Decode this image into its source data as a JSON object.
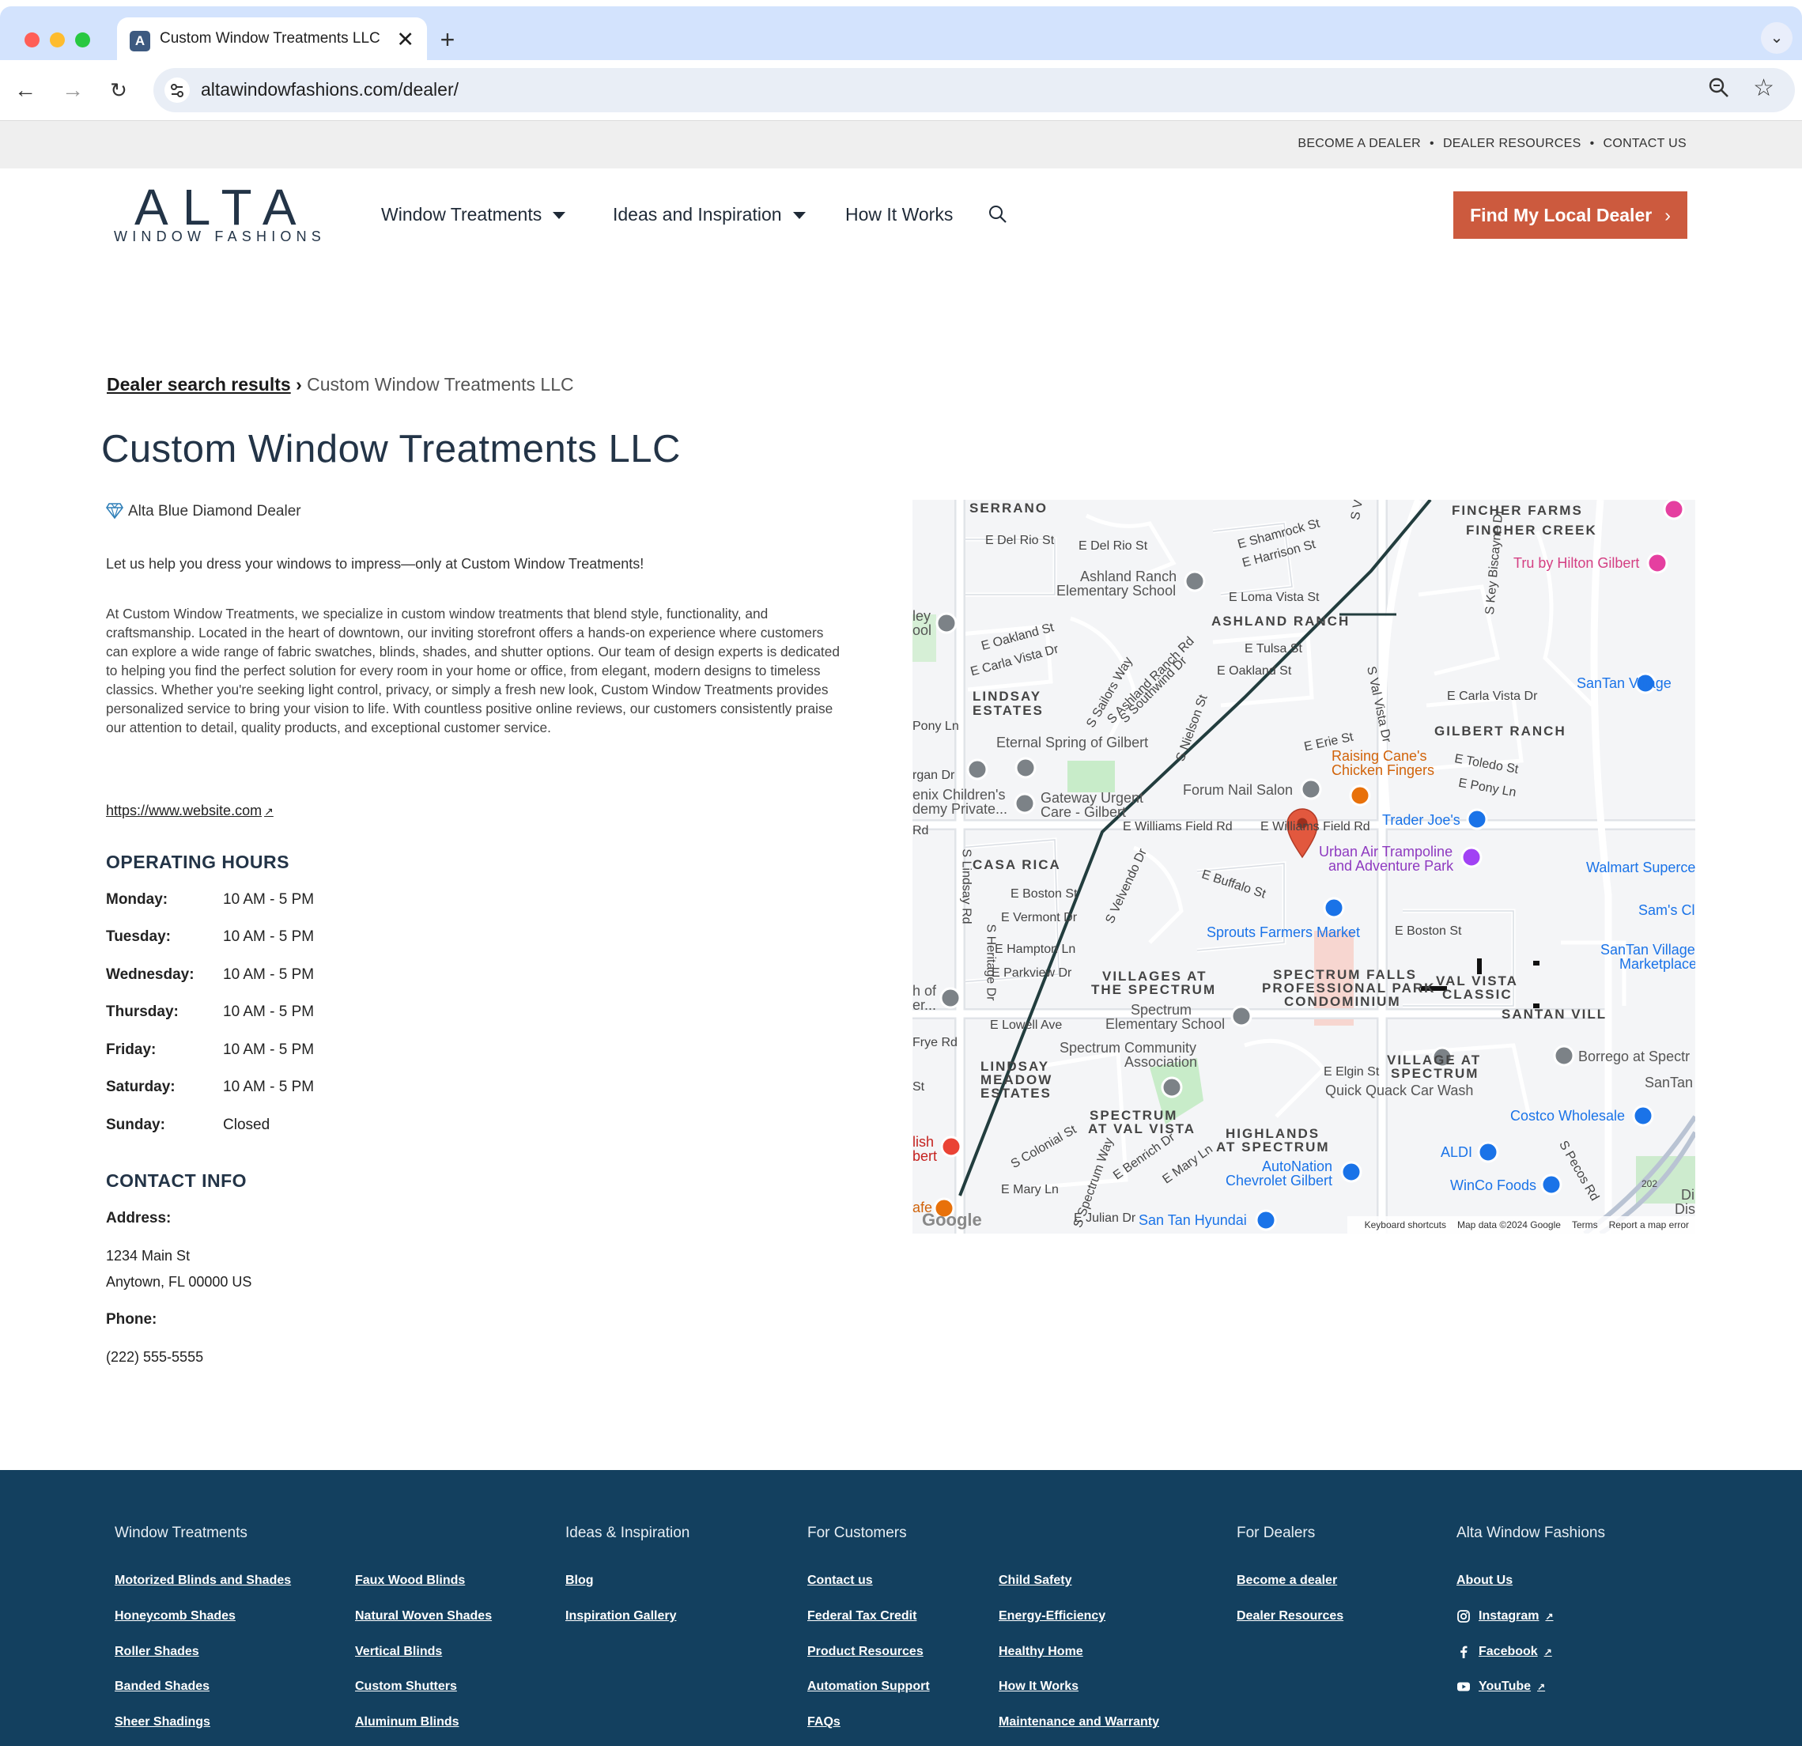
{
  "browser": {
    "tab_title": "Custom Window Treatments LLC",
    "tab_favicon": "A",
    "url": "altawindowfashions.com/dealer/"
  },
  "utility_nav": [
    "BECOME A DEALER",
    "DEALER RESOURCES",
    "CONTACT US"
  ],
  "logo": {
    "word": "ALTA",
    "sub": "WINDOW FASHIONS"
  },
  "main_nav": {
    "window_treatments": "Window Treatments",
    "ideas": "Ideas and Inspiration",
    "how": "How It Works",
    "cta": "Find My Local Dealer"
  },
  "breadcrumb": {
    "link": "Dealer search results",
    "separator": " › ",
    "current": "Custom Window Treatments LLC"
  },
  "dealer": {
    "name": "Custom Window Treatments LLC",
    "badge": "Alta Blue Diamond Dealer",
    "tagline": "Let us help you dress your windows to impress—only at Custom Window Treatments!",
    "about": "At Custom Window Treatments, we specialize in custom window treatments that blend style, functionality, and craftsmanship. Located in the heart of downtown, our inviting storefront offers a hands-on experience where customers can explore a wide range of fabric swatches, blinds, shades, and shutter options. Our team of design experts is dedicated to helping you find the perfect solution for every room in your home or office, from elegant, modern designs to timeless classics. Whether you're seeking light control, privacy, or simply a fresh new look, Custom Window Treatments provides personalized service to bring your vision to life. With countless positive online reviews, our customers consistently praise our attention to detail, quality products, and exceptional customer service.",
    "website": "https://www.website.com"
  },
  "hours": {
    "title": "OPERATING HOURS",
    "rows": [
      {
        "day": "Monday:",
        "time": "10 AM - 5 PM"
      },
      {
        "day": "Tuesday:",
        "time": "10 AM - 5 PM"
      },
      {
        "day": "Wednesday:",
        "time": "10 AM - 5 PM"
      },
      {
        "day": "Thursday:",
        "time": "10 AM - 5 PM"
      },
      {
        "day": "Friday:",
        "time": "10 AM - 5 PM"
      },
      {
        "day": "Saturday:",
        "time": "10 AM - 5 PM"
      },
      {
        "day": "Sunday:",
        "time": "Closed"
      }
    ]
  },
  "contact": {
    "title": "CONTACT INFO",
    "address_label": "Address:",
    "address_line1": "1234 Main St",
    "address_line2": "Anytown, FL 00000 US",
    "phone_label": "Phone:",
    "phone": "(222) 555-5555"
  },
  "map": {
    "neighborhoods": [
      "SERRANO",
      "FINCHER FARMS",
      "FINCHER CREEK",
      "ASHLAND RANCH",
      "LINDSAY",
      "ESTATES",
      "GILBERT RANCH",
      "CASA RICA",
      "VILLAGES AT",
      "THE SPECTRUM",
      "SPECTRUM FALLS",
      "PROFESSIONAL PARK",
      "CONDOMINIUM",
      "VAL VISTA",
      "CLASSIC",
      "SANTAN VILL",
      "VILLAGE AT",
      "SPECTRUM",
      "LINDSAY",
      "MEADOW",
      "ESTATES",
      "SPECTRUM",
      "AT VAL VISTA",
      "HIGHLANDS",
      "AT SPECTRUM"
    ],
    "streets": [
      "E Del Rio St",
      "E Del Rio St",
      "E Shamrock St",
      "E Harrison St",
      "E Loma Vista St",
      "E Oakland St",
      "E Carla Vista Dr",
      "E Tulsa St",
      "E Oakland St",
      "E Carla Vista Dr",
      "E Erie St",
      "E Toledo St",
      "E Pony Ln",
      "E Williams Field Rd",
      "E Williams Field Rd",
      "E Buffalo St",
      "E Boston St",
      "E Vermont Dr",
      "E Hampton Ln",
      "E Parkview Dr",
      "E Boston St",
      "E Lowell Ave",
      "E Elgin St",
      "E Mary Ln",
      "E Julian Dr",
      "S Colonial St",
      "S Lindsay Rd",
      "S Val Vista Dr",
      "S Velvendo Dr",
      "S Heritage Dr",
      "S Nielson St",
      "S Pecos Rd",
      "S Key Biscayne Dr",
      "S Ashland Ranch Rd",
      "S Southwind Dr",
      "S Sailors Way",
      "E Benrich Dr",
      "E Mary Ln",
      "S Spectrum Way",
      "S V"
    ],
    "places": [
      "Ashland Ranch",
      "Elementary School",
      "Eternal Spring of Gilbert",
      "Gateway Urgent",
      "Care - Gilbert",
      "Forum Nail Salon",
      "Raising Cane's",
      "Chicken Fingers",
      "Trader Joe's",
      "Urban Air Trampoline",
      "and Adventure Park",
      "Walmart Superce",
      "Sam's Cl",
      "SanTan Village",
      "Marketplace",
      "SanTan Village",
      "Tru by Hilton Gilbert",
      "Sprouts Farmers Market",
      "Spectrum",
      "Elementary School",
      "Spectrum Community",
      "Association",
      "Quick Quack Car Wash",
      "Borrego at Spectr",
      "SanTan",
      "Costco Wholesale",
      "ALDI",
      "WinCo Foods",
      "AutoNation",
      "Chevrolet Gilbert",
      "San Tan Hyundai",
      "enix Children's",
      "demy Private...",
      "ley",
      "ool",
      "Pony Ln",
      "rgan Dr",
      "Rd",
      "h of",
      "er...",
      "Frye Rd",
      "St",
      "lish",
      "bert",
      "afe",
      "Di",
      "Dis",
      "202"
    ],
    "footer": [
      "Keyboard shortcuts",
      "Map data ©2024 Google",
      "Terms",
      "Report a map error"
    ],
    "brand": "Google"
  },
  "footer": {
    "window_treatments": {
      "title": "Window Treatments",
      "col1": [
        "Motorized Blinds and Shades",
        "Honeycomb Shades",
        "Roller Shades",
        "Banded Shades",
        "Sheer Shadings"
      ],
      "col2": [
        "Faux Wood Blinds",
        "Natural Woven Shades",
        "Vertical Blinds",
        "Custom Shutters",
        "Aluminum Blinds"
      ]
    },
    "ideas": {
      "title": "Ideas & Inspiration",
      "links": [
        "Blog",
        "Inspiration Gallery"
      ]
    },
    "customers": {
      "title": "For Customers",
      "col1": [
        "Contact us",
        "Federal Tax Credit",
        "Product Resources",
        "Automation Support",
        "FAQs"
      ],
      "col2": [
        "Child Safety",
        "Energy-Efficiency",
        "Healthy Home",
        "How It Works",
        "Maintenance and Warranty"
      ]
    },
    "dealers": {
      "title": "For Dealers",
      "links": [
        "Become a dealer",
        "Dealer Resources"
      ]
    },
    "alta": {
      "title": "Alta Window Fashions",
      "links": [
        "About Us",
        "Instagram",
        "Facebook",
        "YouTube"
      ]
    }
  },
  "colors": {
    "brand_navy": "#233447",
    "cta": "#cc5a3e",
    "footer_bg": "#13405f",
    "map_pin": "#e2583e"
  }
}
